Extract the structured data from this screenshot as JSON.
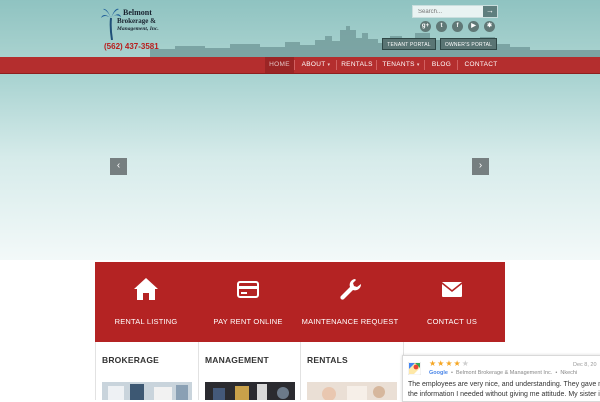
{
  "header": {
    "logo": {
      "line1": "Belmont",
      "line2": "Brokerage &",
      "line3": "Management, Inc.",
      "phone": "(562) 437-3581"
    },
    "search": {
      "placeholder": "Search...",
      "button_icon": "arrow-right-icon"
    },
    "social": [
      {
        "name": "google-plus-icon",
        "glyph": "g+"
      },
      {
        "name": "twitter-icon",
        "glyph": "t"
      },
      {
        "name": "facebook-icon",
        "glyph": "f"
      },
      {
        "name": "youtube-icon",
        "glyph": "▶"
      },
      {
        "name": "yelp-icon",
        "glyph": "✱"
      }
    ],
    "portals": [
      "TENANT PORTAL",
      "OWNER'S PORTAL"
    ]
  },
  "nav": {
    "items": [
      {
        "label": "HOME",
        "active": true,
        "dropdown": false
      },
      {
        "label": "ABOUT",
        "active": false,
        "dropdown": true
      },
      {
        "label": "RENTALS",
        "active": false,
        "dropdown": false
      },
      {
        "label": "TENANTS",
        "active": false,
        "dropdown": true
      },
      {
        "label": "BLOG",
        "active": false,
        "dropdown": false
      },
      {
        "label": "CONTACT",
        "active": false,
        "dropdown": false
      }
    ],
    "dropdown_glyph": "▾"
  },
  "slider": {
    "prev_glyph": "‹",
    "next_glyph": "›"
  },
  "features": [
    {
      "label": "RENTAL LISTING",
      "icon": "home-icon"
    },
    {
      "label": "PAY RENT ONLINE",
      "icon": "credit-card-icon"
    },
    {
      "label": "MAINTENANCE REQUEST",
      "icon": "wrench-icon"
    },
    {
      "label": "CONTACT US",
      "icon": "envelope-icon"
    }
  ],
  "sections": [
    "BROKERAGE",
    "MANAGEMENT",
    "RENTALS"
  ],
  "review": {
    "rating": 4,
    "max_rating": 5,
    "source": "Google",
    "business": "Belmont Brokerage & Management Inc.",
    "author": "Nkechi",
    "date": "Dec 8, 20",
    "line1": "The employees are very nice, and understanding. They gave me",
    "line2": "the information I needed without giving me attitude. My sister is"
  },
  "colors": {
    "header_teal": "#a9d2cf",
    "nav_red": "#b42e2e",
    "banner_red": "#b42323",
    "star": "#f5a623"
  }
}
